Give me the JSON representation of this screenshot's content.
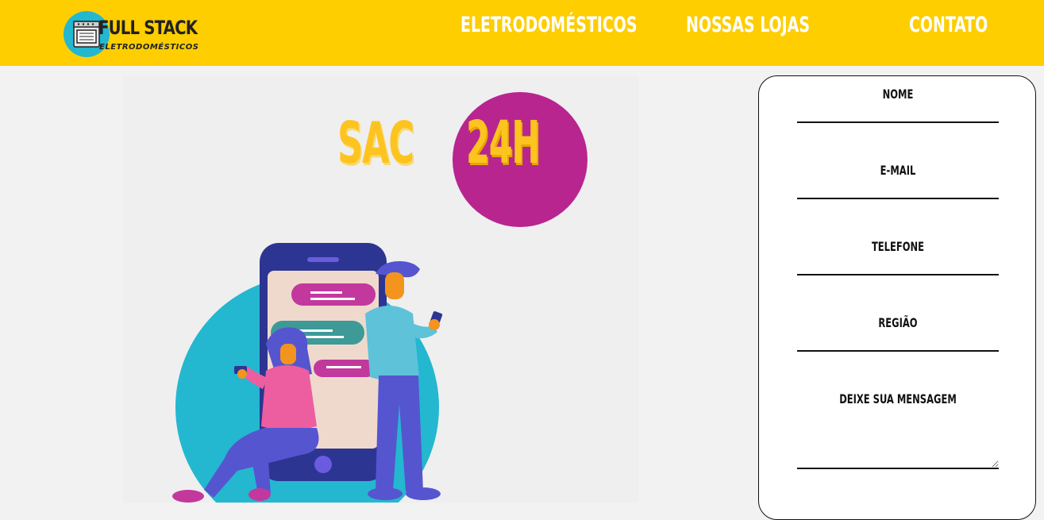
{
  "header": {
    "logo": {
      "title": "FULL STACK",
      "subtitle": "ELETRODOMÉSTICOS",
      "icon": "stove-icon"
    },
    "nav": [
      {
        "label": "ELETRODOMÉSTICOS"
      },
      {
        "label": "NOSSAS LOJAS"
      },
      {
        "label": "CONTATO"
      }
    ]
  },
  "hero": {
    "sac_label": "SAC",
    "hours_label": "24H",
    "illustration": "people-chatting-on-phone-illustration"
  },
  "form": {
    "fields": [
      {
        "label": "NOME",
        "value": ""
      },
      {
        "label": "E-MAIL",
        "value": ""
      },
      {
        "label": "TELEFONE",
        "value": ""
      },
      {
        "label": "REGIÃO",
        "value": ""
      },
      {
        "label": "DEIXE SUA MENSAGEM",
        "value": ""
      }
    ]
  },
  "colors": {
    "header_bg": "#fece00",
    "accent_magenta": "#b8258f",
    "accent_yellow": "#fdc420",
    "accent_cyan": "#24b7d0"
  }
}
